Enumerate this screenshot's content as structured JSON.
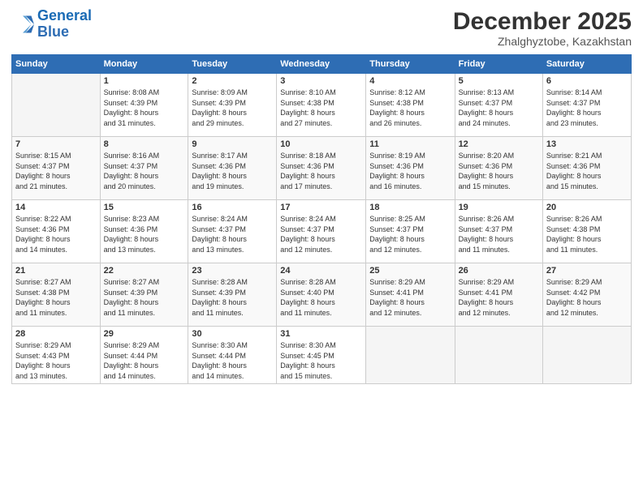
{
  "logo": {
    "line1": "General",
    "line2": "Blue"
  },
  "title": "December 2025",
  "subtitle": "Zhalghyztobe, Kazakhstan",
  "days_header": [
    "Sunday",
    "Monday",
    "Tuesday",
    "Wednesday",
    "Thursday",
    "Friday",
    "Saturday"
  ],
  "weeks": [
    [
      {
        "day": "",
        "info": ""
      },
      {
        "day": "1",
        "info": "Sunrise: 8:08 AM\nSunset: 4:39 PM\nDaylight: 8 hours\nand 31 minutes."
      },
      {
        "day": "2",
        "info": "Sunrise: 8:09 AM\nSunset: 4:39 PM\nDaylight: 8 hours\nand 29 minutes."
      },
      {
        "day": "3",
        "info": "Sunrise: 8:10 AM\nSunset: 4:38 PM\nDaylight: 8 hours\nand 27 minutes."
      },
      {
        "day": "4",
        "info": "Sunrise: 8:12 AM\nSunset: 4:38 PM\nDaylight: 8 hours\nand 26 minutes."
      },
      {
        "day": "5",
        "info": "Sunrise: 8:13 AM\nSunset: 4:37 PM\nDaylight: 8 hours\nand 24 minutes."
      },
      {
        "day": "6",
        "info": "Sunrise: 8:14 AM\nSunset: 4:37 PM\nDaylight: 8 hours\nand 23 minutes."
      }
    ],
    [
      {
        "day": "7",
        "info": "Sunrise: 8:15 AM\nSunset: 4:37 PM\nDaylight: 8 hours\nand 21 minutes."
      },
      {
        "day": "8",
        "info": "Sunrise: 8:16 AM\nSunset: 4:37 PM\nDaylight: 8 hours\nand 20 minutes."
      },
      {
        "day": "9",
        "info": "Sunrise: 8:17 AM\nSunset: 4:36 PM\nDaylight: 8 hours\nand 19 minutes."
      },
      {
        "day": "10",
        "info": "Sunrise: 8:18 AM\nSunset: 4:36 PM\nDaylight: 8 hours\nand 17 minutes."
      },
      {
        "day": "11",
        "info": "Sunrise: 8:19 AM\nSunset: 4:36 PM\nDaylight: 8 hours\nand 16 minutes."
      },
      {
        "day": "12",
        "info": "Sunrise: 8:20 AM\nSunset: 4:36 PM\nDaylight: 8 hours\nand 15 minutes."
      },
      {
        "day": "13",
        "info": "Sunrise: 8:21 AM\nSunset: 4:36 PM\nDaylight: 8 hours\nand 15 minutes."
      }
    ],
    [
      {
        "day": "14",
        "info": "Sunrise: 8:22 AM\nSunset: 4:36 PM\nDaylight: 8 hours\nand 14 minutes."
      },
      {
        "day": "15",
        "info": "Sunrise: 8:23 AM\nSunset: 4:36 PM\nDaylight: 8 hours\nand 13 minutes."
      },
      {
        "day": "16",
        "info": "Sunrise: 8:24 AM\nSunset: 4:37 PM\nDaylight: 8 hours\nand 13 minutes."
      },
      {
        "day": "17",
        "info": "Sunrise: 8:24 AM\nSunset: 4:37 PM\nDaylight: 8 hours\nand 12 minutes."
      },
      {
        "day": "18",
        "info": "Sunrise: 8:25 AM\nSunset: 4:37 PM\nDaylight: 8 hours\nand 12 minutes."
      },
      {
        "day": "19",
        "info": "Sunrise: 8:26 AM\nSunset: 4:37 PM\nDaylight: 8 hours\nand 11 minutes."
      },
      {
        "day": "20",
        "info": "Sunrise: 8:26 AM\nSunset: 4:38 PM\nDaylight: 8 hours\nand 11 minutes."
      }
    ],
    [
      {
        "day": "21",
        "info": "Sunrise: 8:27 AM\nSunset: 4:38 PM\nDaylight: 8 hours\nand 11 minutes."
      },
      {
        "day": "22",
        "info": "Sunrise: 8:27 AM\nSunset: 4:39 PM\nDaylight: 8 hours\nand 11 minutes."
      },
      {
        "day": "23",
        "info": "Sunrise: 8:28 AM\nSunset: 4:39 PM\nDaylight: 8 hours\nand 11 minutes."
      },
      {
        "day": "24",
        "info": "Sunrise: 8:28 AM\nSunset: 4:40 PM\nDaylight: 8 hours\nand 11 minutes."
      },
      {
        "day": "25",
        "info": "Sunrise: 8:29 AM\nSunset: 4:41 PM\nDaylight: 8 hours\nand 12 minutes."
      },
      {
        "day": "26",
        "info": "Sunrise: 8:29 AM\nSunset: 4:41 PM\nDaylight: 8 hours\nand 12 minutes."
      },
      {
        "day": "27",
        "info": "Sunrise: 8:29 AM\nSunset: 4:42 PM\nDaylight: 8 hours\nand 12 minutes."
      }
    ],
    [
      {
        "day": "28",
        "info": "Sunrise: 8:29 AM\nSunset: 4:43 PM\nDaylight: 8 hours\nand 13 minutes."
      },
      {
        "day": "29",
        "info": "Sunrise: 8:29 AM\nSunset: 4:44 PM\nDaylight: 8 hours\nand 14 minutes."
      },
      {
        "day": "30",
        "info": "Sunrise: 8:30 AM\nSunset: 4:44 PM\nDaylight: 8 hours\nand 14 minutes."
      },
      {
        "day": "31",
        "info": "Sunrise: 8:30 AM\nSunset: 4:45 PM\nDaylight: 8 hours\nand 15 minutes."
      },
      {
        "day": "",
        "info": ""
      },
      {
        "day": "",
        "info": ""
      },
      {
        "day": "",
        "info": ""
      }
    ]
  ]
}
